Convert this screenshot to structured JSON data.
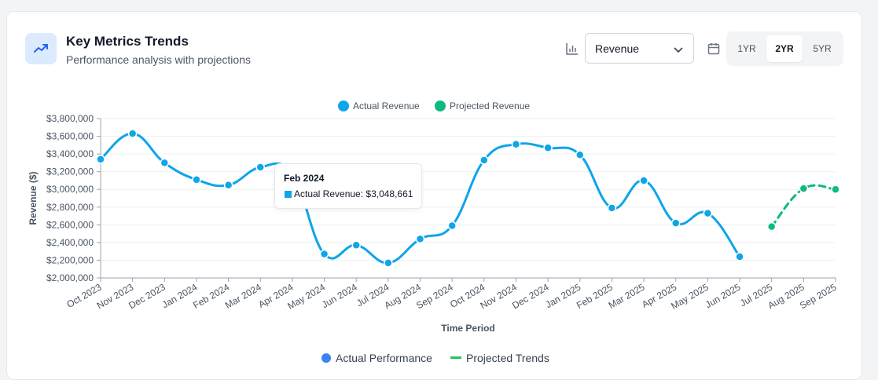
{
  "header": {
    "title": "Key Metrics Trends",
    "subtitle": "Performance analysis with projections"
  },
  "controls": {
    "metric_select": "Revenue",
    "ranges": [
      "1YR",
      "2YR",
      "5YR"
    ],
    "active_range": "2YR"
  },
  "tooltip": {
    "title": "Feb 2024",
    "text": "Actual Revenue: $3,048,661"
  },
  "bottom_legend": {
    "actual": "Actual Performance",
    "projected": "Projected Trends"
  },
  "colors": {
    "actual": "#0ea5e9",
    "projected": "#10b981",
    "actual_dot": "#3b82f6",
    "projected_dash": "#22c55e"
  },
  "chart_data": {
    "type": "line",
    "xlabel": "Time Period",
    "ylabel": "Revenue ($)",
    "ylim": [
      2000000,
      3800000
    ],
    "yticks": [
      2000000,
      2200000,
      2400000,
      2600000,
      2800000,
      3000000,
      3200000,
      3400000,
      3600000,
      3800000
    ],
    "ytick_labels": [
      "$2,000,000",
      "$2,200,000",
      "$2,400,000",
      "$2,600,000",
      "$2,800,000",
      "$3,000,000",
      "$3,200,000",
      "$3,400,000",
      "$3,600,000",
      "$3,800,000"
    ],
    "categories": [
      "Oct 2023",
      "Nov 2023",
      "Dec 2023",
      "Jan 2024",
      "Feb 2024",
      "Mar 2024",
      "Apr 2024",
      "May 2024",
      "Jun 2024",
      "Jul 2024",
      "Aug 2024",
      "Sep 2024",
      "Oct 2024",
      "Nov 2024",
      "Dec 2024",
      "Jan 2025",
      "Feb 2025",
      "Mar 2025",
      "Apr 2025",
      "May 2025",
      "Jun 2025",
      "Jul 2025",
      "Aug 2025",
      "Sep 2025"
    ],
    "legend": "top-center",
    "grid": true,
    "series": [
      {
        "name": "Actual Revenue",
        "values": [
          3340000,
          3630000,
          3300000,
          3110000,
          3048661,
          3250000,
          3170000,
          2270000,
          2370000,
          2170000,
          2440000,
          2590000,
          3330000,
          3510000,
          3470000,
          3390000,
          2790000,
          3100000,
          2620000,
          2730000,
          2240000,
          null,
          null,
          null
        ]
      },
      {
        "name": "Projected Revenue",
        "values": [
          null,
          null,
          null,
          null,
          null,
          null,
          null,
          null,
          null,
          null,
          null,
          null,
          null,
          null,
          null,
          null,
          null,
          null,
          null,
          null,
          null,
          2580000,
          3010000,
          3000000
        ]
      }
    ]
  }
}
